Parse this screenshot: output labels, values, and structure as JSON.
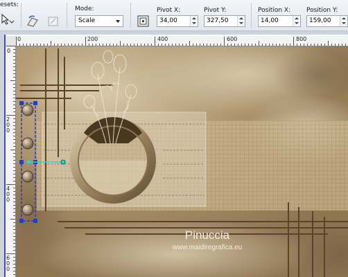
{
  "toolbar": {
    "presets_label": "esets:",
    "mode_label": "Mode:",
    "mode_value": "Scale",
    "pivot_x_label": "Pivot X:",
    "pivot_x_value": "34,00",
    "pivot_y_label": "Pivot Y:",
    "pivot_y_value": "327,50",
    "position_x_label": "Position X:",
    "position_x_value": "14,00",
    "position_y_label": "Position Y:",
    "position_y_value": "159,00"
  },
  "ruler": {
    "h_labels": [
      "0",
      "200",
      "400",
      "600",
      "800"
    ],
    "v_labels": [
      "0",
      "200",
      "400",
      "600"
    ]
  },
  "image": {
    "watermark_name": "Pinuccia",
    "watermark_url": "www.maidiregrafica.eu"
  },
  "colors": {
    "selection": "#1f3fd4",
    "pivot_line": "#2fd6c8",
    "background_tan": "#a38b66"
  }
}
